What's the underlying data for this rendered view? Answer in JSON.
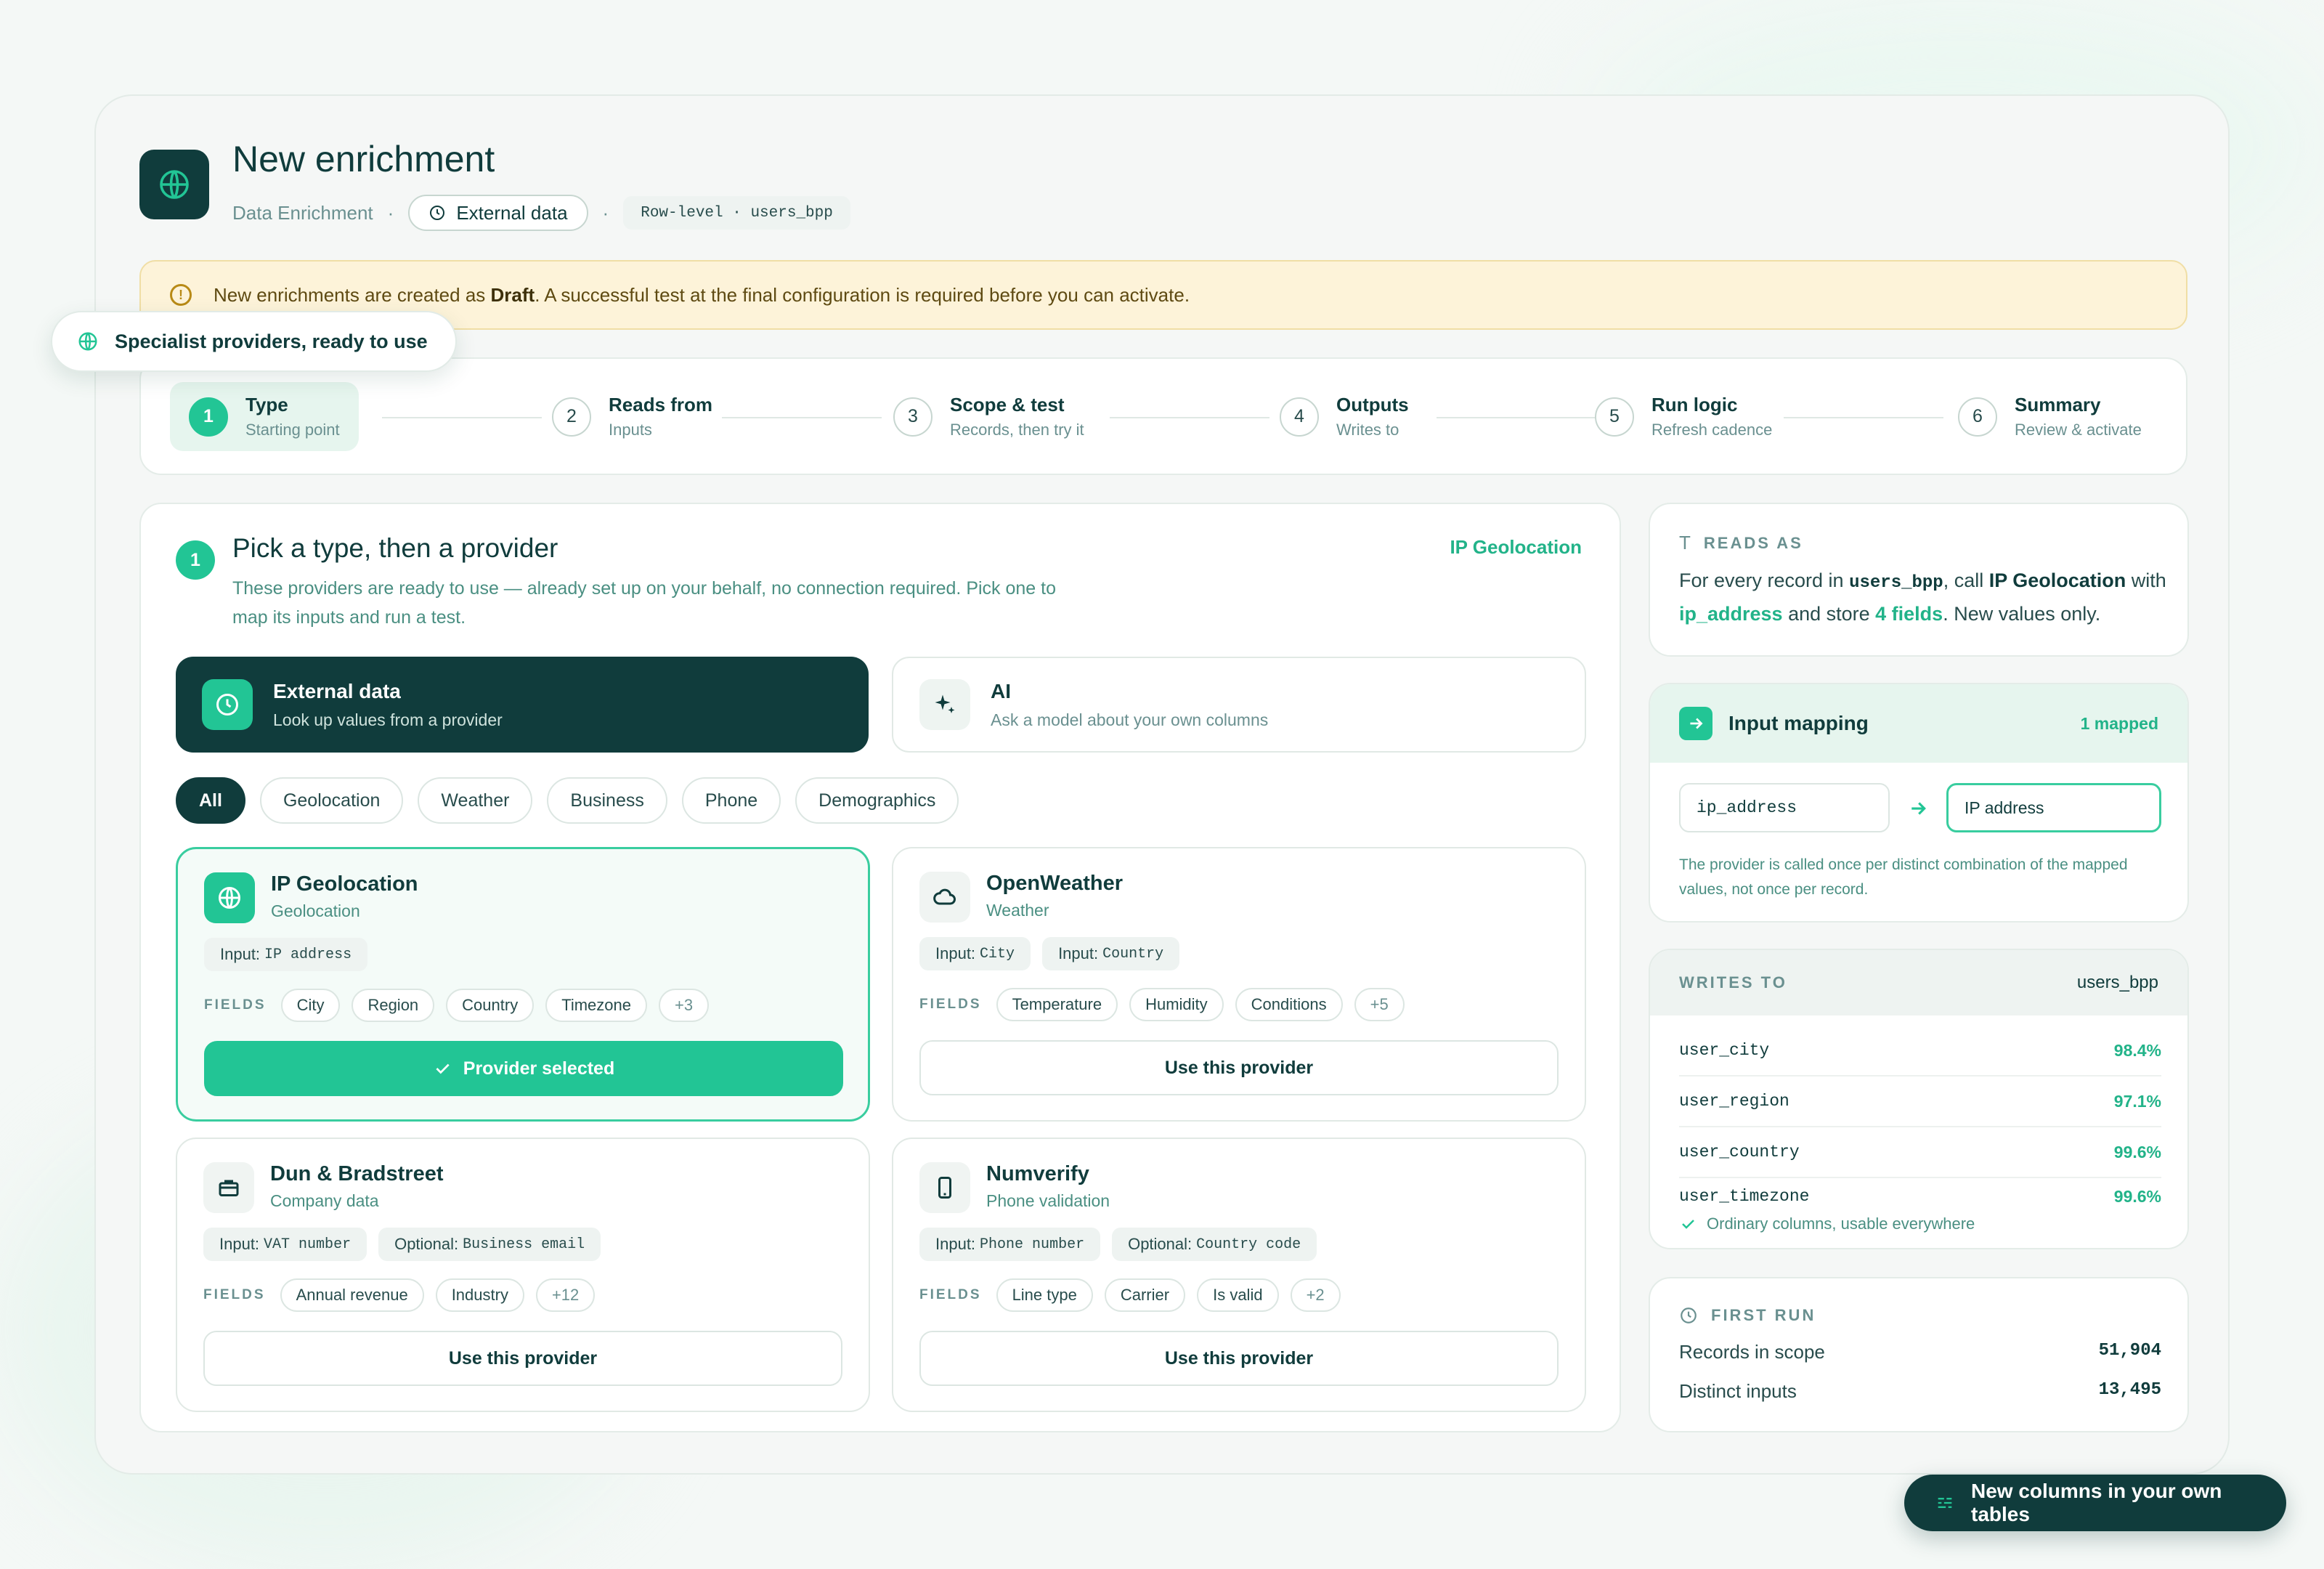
{
  "header": {
    "title": "New enrichment",
    "breadcrumb": "Data Enrichment",
    "chip_external": "External data",
    "chip_row": "Row-level · users_bpp"
  },
  "notice": {
    "before": "New enrichments are created as ",
    "bold": "Draft",
    "after": ". A successful test at the final configuration is required before you can activate."
  },
  "float_chip": "Specialist providers, ready to use",
  "steps": [
    {
      "num": "1",
      "title": "Type",
      "sub": "Starting point"
    },
    {
      "num": "2",
      "title": "Reads from",
      "sub": "Inputs"
    },
    {
      "num": "3",
      "title": "Scope & test",
      "sub": "Records, then try it"
    },
    {
      "num": "4",
      "title": "Outputs",
      "sub": "Writes to"
    },
    {
      "num": "5",
      "title": "Run logic",
      "sub": "Refresh cadence"
    },
    {
      "num": "6",
      "title": "Summary",
      "sub": "Review & activate"
    }
  ],
  "section": {
    "num": "1",
    "title": "Pick a type, then a provider",
    "desc": "These providers are ready to use — already set up on your behalf, no connection required. Pick one to map its inputs and run a test.",
    "tag": "IP Geolocation"
  },
  "types": [
    {
      "title": "External data",
      "sub": "Look up values from a provider"
    },
    {
      "title": "AI",
      "sub": "Ask a model about your own columns"
    }
  ],
  "filters": [
    "All",
    "Geolocation",
    "Weather",
    "Business",
    "Phone",
    "Demographics"
  ],
  "fields_label": "FIELDS",
  "providers": [
    {
      "name": "IP Geolocation",
      "category": "Geolocation",
      "inputs": [
        {
          "label": "Input:",
          "value": "IP address"
        }
      ],
      "fields": [
        "City",
        "Region",
        "Country",
        "Timezone"
      ],
      "more": "+3",
      "button": "Provider selected"
    },
    {
      "name": "OpenWeather",
      "category": "Weather",
      "inputs": [
        {
          "label": "Input:",
          "value": "City"
        },
        {
          "label": "Input:",
          "value": "Country"
        }
      ],
      "fields": [
        "Temperature",
        "Humidity",
        "Conditions"
      ],
      "more": "+5",
      "button": "Use this provider"
    },
    {
      "name": "Dun & Bradstreet",
      "category": "Company data",
      "inputs": [
        {
          "label": "Input:",
          "value": "VAT number"
        },
        {
          "label": "Optional:",
          "value": "Business email"
        }
      ],
      "fields": [
        "Annual revenue",
        "Industry"
      ],
      "more": "+12",
      "button": "Use this provider"
    },
    {
      "name": "Numverify",
      "category": "Phone validation",
      "inputs": [
        {
          "label": "Input:",
          "value": "Phone number"
        },
        {
          "label": "Optional:",
          "value": "Country code"
        }
      ],
      "fields": [
        "Line type",
        "Carrier",
        "Is valid"
      ],
      "more": "+2",
      "button": "Use this provider"
    }
  ],
  "reads_as": {
    "caption": "READS AS",
    "t1": "For every record in ",
    "table": "users_bpp",
    "t2": ", call ",
    "provider": "IP Geolocation",
    "t3": " with ",
    "input": "ip_address",
    "t4": " and store ",
    "fields": "4 fields",
    "t5": ". New values only."
  },
  "input_mapping": {
    "title": "Input mapping",
    "status": "1 mapped",
    "source": "ip_address",
    "target": "IP address",
    "note": "The provider is called once per distinct combination of the mapped values, not once per record."
  },
  "writes_to": {
    "caption": "WRITES TO",
    "table": "users_bpp",
    "rows": [
      {
        "column": "user_city",
        "pct": "98.4%"
      },
      {
        "column": "user_region",
        "pct": "97.1%"
      },
      {
        "column": "user_country",
        "pct": "99.6%"
      },
      {
        "column": "user_timezone",
        "pct": "99.6%"
      }
    ],
    "footer": "Ordinary columns, usable everywhere"
  },
  "first_run": {
    "caption": "FIRST RUN",
    "records_label": "Records in scope",
    "records_value": "51,904",
    "distinct_label": "Distinct inputs",
    "distinct_value": "13,495"
  },
  "bottom_chip": "New columns in your own tables",
  "colors": {
    "brand_dark": "#103c3c",
    "accent": "#22c595",
    "accent_text": "#22b389",
    "warning_bg": "#fdf3d9"
  },
  "icons": {
    "header": "globe-icon",
    "external": "clock-icon",
    "ai": "sparkle-icon",
    "geolocation": "globe-icon",
    "weather": "cloud-icon",
    "business": "briefcase-icon",
    "phone": "phone-icon"
  }
}
